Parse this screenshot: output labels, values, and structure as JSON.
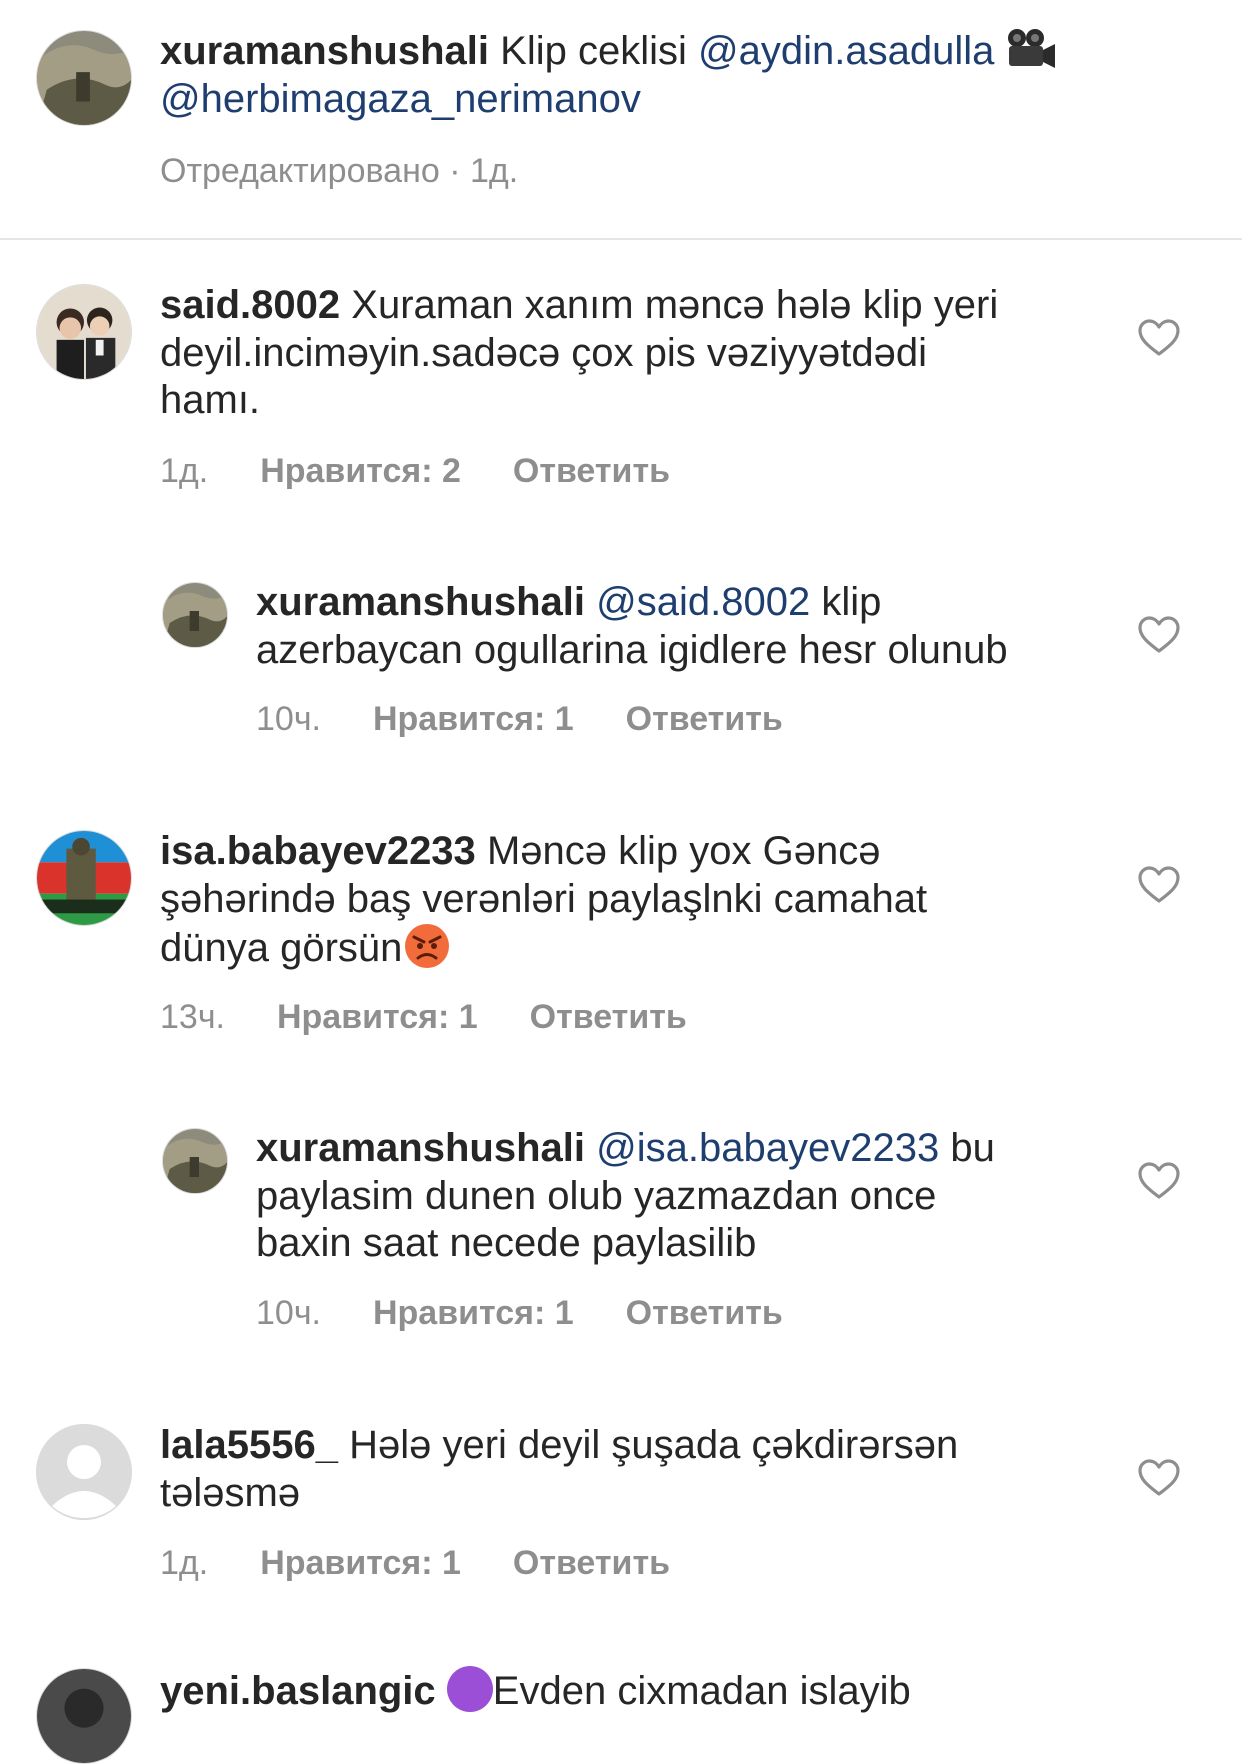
{
  "caption": {
    "username": "xuramanshushali",
    "text": "Klip ceklisi",
    "mention1": "@aydin.asadulla",
    "camera_emoji": "🎥",
    "mention2": "@herbimagaza_nerimanov",
    "meta": "Отредактировано · 1д."
  },
  "comments": [
    {
      "username": "said.8002",
      "text": "Xuraman xanım məncə hələ klip yeri deyil.inciməyin.sadəcə çox pis vəziyyətdədi hamı.",
      "time": "1д.",
      "likes": "Нравится: 2",
      "reply": "Ответить",
      "line1": "Xuraman xanım məncə hələ klip yeri",
      "line2": "deyil.inciməyin.sadəcə çox pis vəziyyətdədi",
      "line3": "hamı."
    },
    {
      "username": "xuramanshushali",
      "mention": "@said.8002",
      "line1": "klip",
      "line2": "azerbaycan ogullarina igidlere hesr olunub",
      "time": "10ч.",
      "likes": "Нравится: 1",
      "reply": "Ответить"
    },
    {
      "username": "isa.babayev2233",
      "line1": "Məncə klip yox Gəncə",
      "line2": "şəhərində baş verənləri paylaşlnki camahat",
      "line3": "dünya görsün",
      "emoji": "😡",
      "time": "13ч.",
      "likes": "Нравится: 1",
      "reply": "Ответить"
    },
    {
      "username": "xuramanshushali",
      "mention": "@isa.babayev2233",
      "line1": "bu",
      "line2": "paylasim dunen olub yazmazdan once",
      "line3": "baxin saat necede paylasilib",
      "time": "10ч.",
      "likes": "Нравится: 1",
      "reply": "Ответить"
    },
    {
      "username": "lala5556_",
      "line1": "Hələ yeri deyil şuşada çəkdirərsən",
      "line2": "tələsmə",
      "time": "1д.",
      "likes": "Нравится: 1",
      "reply": "Ответить"
    },
    {
      "username": "yeni.baslangic",
      "line1": "Evden cixmadan islayib"
    }
  ],
  "icons": {
    "heart": "heart-outline-icon",
    "camera": "movie-camera-icon",
    "angry": "angry-face-emoji"
  }
}
